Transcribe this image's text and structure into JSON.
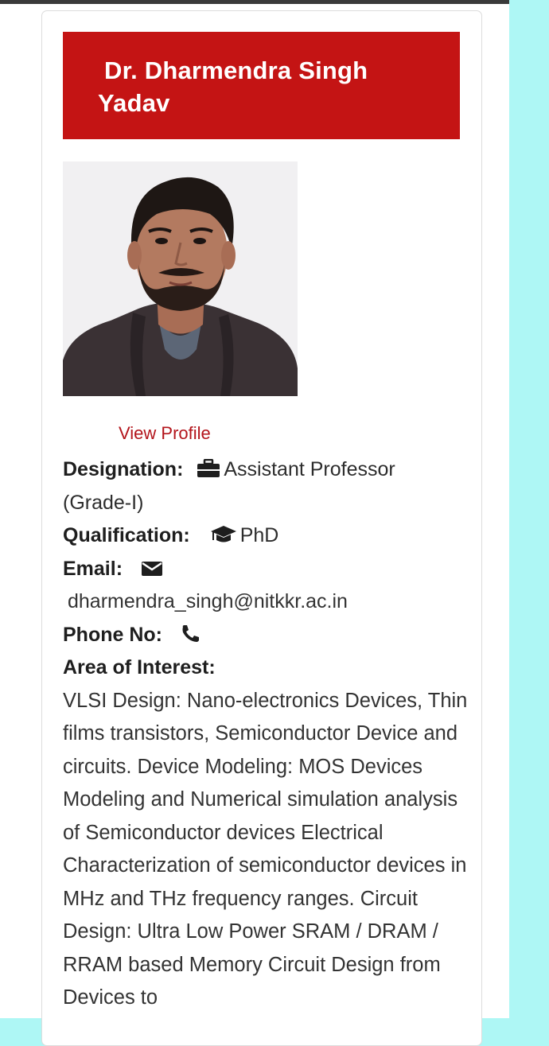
{
  "profile": {
    "name_line1": "Dr. Dharmendra Singh",
    "name_line2": "Yadav",
    "photo_alt": "Profile photo",
    "view_profile_label": "View Profile"
  },
  "fields": {
    "designation_label": "Designation:",
    "designation_icon": "briefcase-icon",
    "designation_value": "Assistant Professor (Grade-I)",
    "qualification_label": "Qualification:",
    "qualification_icon": "graduation-cap-icon",
    "qualification_value": "PhD",
    "email_label": "Email:",
    "email_icon": "envelope-icon",
    "email_value": "dharmendra_singh@nitkkr.ac.in",
    "phone_label": "Phone No:",
    "phone_icon": "phone-icon",
    "area_label": "Area of Interest:",
    "area_value": "VLSI Design: Nano-electronics Devices, Thin films transistors, Semiconductor Device and circuits. Device Modeling: MOS Devices Modeling and Numerical simulation analysis of Semiconductor devices Electrical Characterization of semiconductor devices in MHz and THz frequency ranges. Circuit Design: Ultra Low Power SRAM / DRAM / RRAM based Memory Circuit Design from Devices to"
  },
  "colors": {
    "banner": "#c41414",
    "link": "#b3141b",
    "page_background": "#aef7f5"
  }
}
